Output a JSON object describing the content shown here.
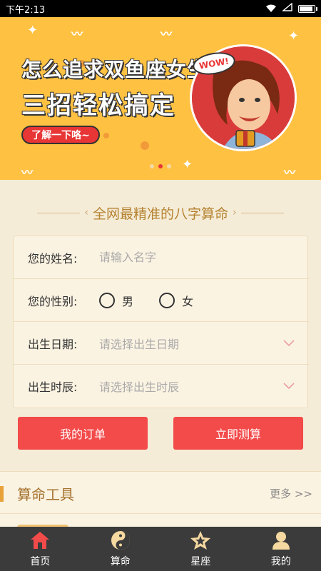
{
  "status": {
    "time": "下午2:13"
  },
  "banner": {
    "title_line1": "怎么追求双鱼座女生",
    "title_line2": "三招轻松搞定",
    "cta": "了解一下咯~",
    "bubble": "WOW!"
  },
  "section": {
    "title": "全网最精准的八字算命"
  },
  "form": {
    "name": {
      "label": "您的姓名:",
      "placeholder": "请输入名字"
    },
    "gender": {
      "label": "您的性别:",
      "options": [
        "男",
        "女"
      ]
    },
    "birth_date": {
      "label": "出生日期:",
      "placeholder": "请选择出生日期"
    },
    "birth_time": {
      "label": "出生时辰:",
      "placeholder": "请选择出生时辰"
    }
  },
  "actions": {
    "orders": "我的订单",
    "calculate": "立即测算"
  },
  "tools": {
    "title": "算命工具",
    "more": "更多 >>"
  },
  "tabbar": [
    {
      "label": "首页",
      "icon": "home-icon"
    },
    {
      "label": "算命",
      "icon": "yin-yang-icon"
    },
    {
      "label": "星座",
      "icon": "star-icon"
    },
    {
      "label": "我的",
      "icon": "user-icon"
    }
  ],
  "colors": {
    "accent": "#f34a4a",
    "banner": "#ffc142",
    "gold": "#b5822f",
    "tabbar": "#3b3b3b"
  }
}
